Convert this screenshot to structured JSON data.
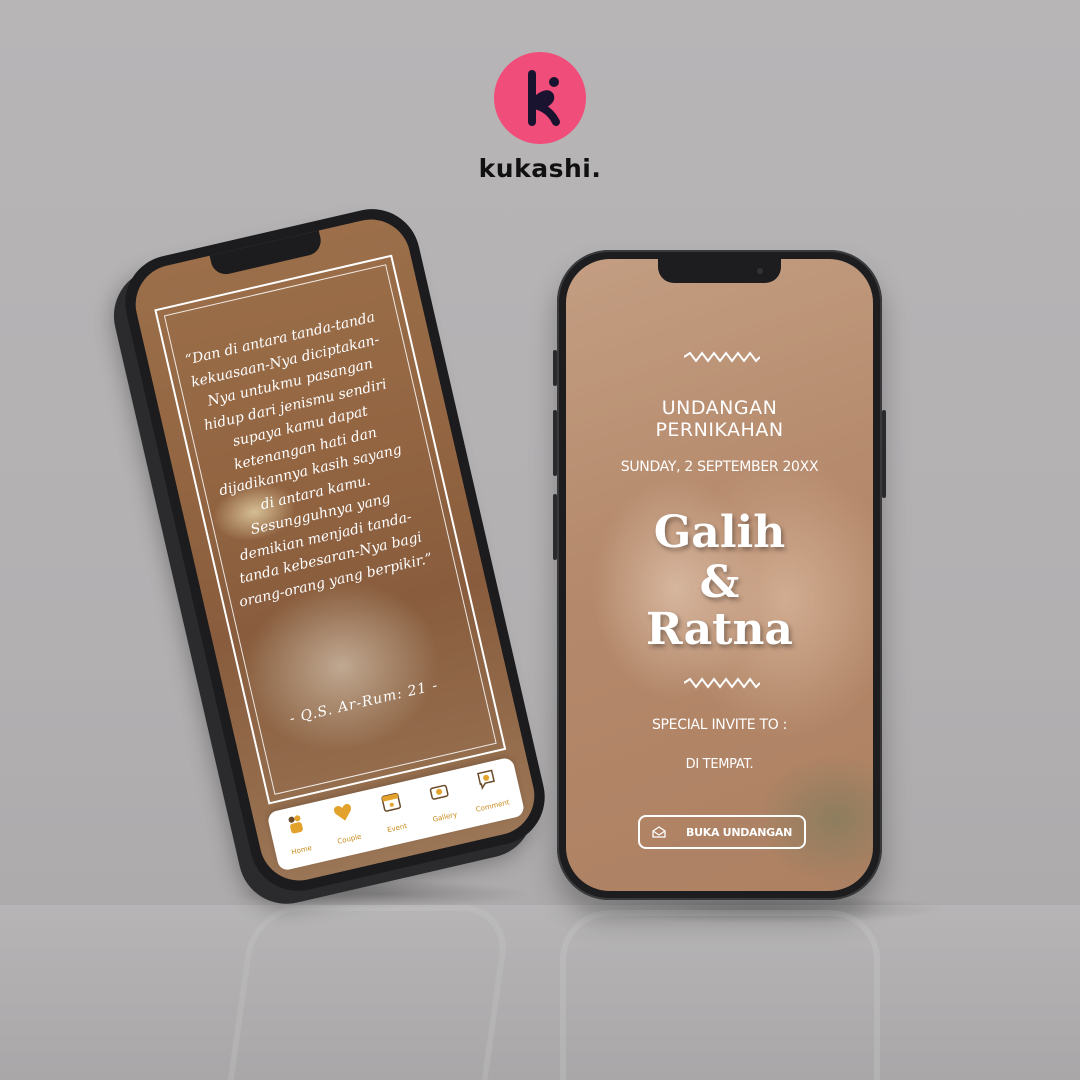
{
  "brand": {
    "name": "kukashi.",
    "logo_letter": "k",
    "logo_color": "#f04d7a"
  },
  "invitation": {
    "title_line1": "UNDANGAN",
    "title_line2": "PERNIKAHAN",
    "date": "SUNDAY, 2 SEPTEMBER 20XX",
    "name1": "Galih",
    "ampersand": "&",
    "name2": "Ratna",
    "invite_label": "SPECIAL INVITE TO :",
    "place": "DI TEMPAT.",
    "open_button": "BUKA UNDANGAN"
  },
  "quote": {
    "text": "“Dan di antara tanda-tanda kekuasaan-Nya diciptakan-Nya untukmu pasangan hidup dari jenismu sendiri supaya kamu dapat ketenangan hati dan dijadikannya kasih sayang di antara kamu. Sesungguhnya yang demikian menjadi tanda-tanda kebesaran-Nya bagi orang-orang yang berpikir.”",
    "source": "- Q.S. Ar-Rum: 21 -"
  },
  "bottom_nav": {
    "items": [
      {
        "label": "Home",
        "icon": "couple-icon"
      },
      {
        "label": "Couple",
        "icon": "heart-icon"
      },
      {
        "label": "Event",
        "icon": "calendar-icon"
      },
      {
        "label": "Gallery",
        "icon": "camera-icon"
      },
      {
        "label": "Comment",
        "icon": "chat-icon"
      }
    ]
  }
}
